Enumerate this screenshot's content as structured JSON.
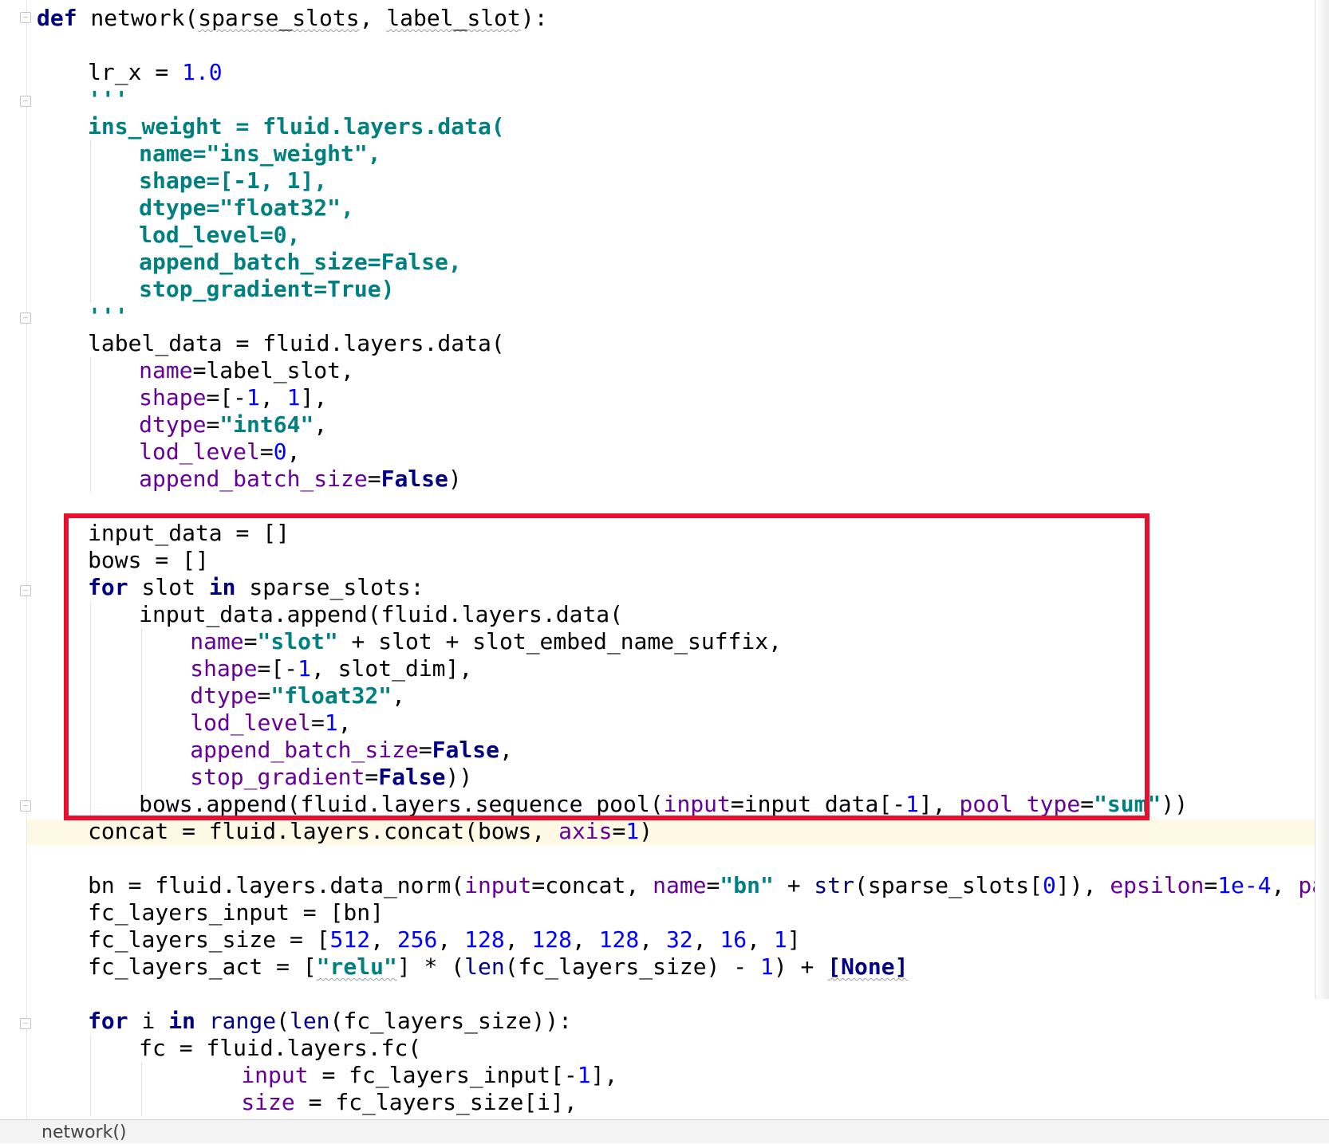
{
  "editor": {
    "lines": [
      {
        "indent": 0,
        "guides": [],
        "tokens": [
          {
            "t": "def",
            "c": "kw"
          },
          {
            "t": " network("
          },
          {
            "t": "sparse_slots",
            "c": "ul"
          },
          {
            "t": ", "
          },
          {
            "t": "label_slot",
            "c": "ul"
          },
          {
            "t": "):"
          }
        ]
      },
      {
        "indent": 0,
        "guides": [],
        "tokens": []
      },
      {
        "indent": 4,
        "guides": [],
        "tokens": [
          {
            "t": "lr_x = "
          },
          {
            "t": "1.0",
            "c": "num"
          }
        ]
      },
      {
        "indent": 4,
        "guides": [],
        "tokens": [
          {
            "t": "'''",
            "c": "doc"
          }
        ]
      },
      {
        "indent": 4,
        "guides": [],
        "tokens": [
          {
            "t": "ins_weight = fluid.layers.data(",
            "c": "doc"
          }
        ]
      },
      {
        "indent": 8,
        "guides": [
          4
        ],
        "tokens": [
          {
            "t": "name=\"ins_weight\",",
            "c": "doc"
          }
        ]
      },
      {
        "indent": 8,
        "guides": [
          4
        ],
        "tokens": [
          {
            "t": "shape=[-1, 1],",
            "c": "doc"
          }
        ]
      },
      {
        "indent": 8,
        "guides": [
          4
        ],
        "tokens": [
          {
            "t": "dtype=\"float32\",",
            "c": "doc"
          }
        ]
      },
      {
        "indent": 8,
        "guides": [
          4
        ],
        "tokens": [
          {
            "t": "lod_level=0,",
            "c": "doc"
          }
        ]
      },
      {
        "indent": 8,
        "guides": [
          4
        ],
        "tokens": [
          {
            "t": "append_batch_size=False,",
            "c": "doc"
          }
        ]
      },
      {
        "indent": 8,
        "guides": [
          4
        ],
        "tokens": [
          {
            "t": "stop_gradient=True)",
            "c": "doc"
          }
        ]
      },
      {
        "indent": 4,
        "guides": [],
        "tokens": [
          {
            "t": "'''",
            "c": "doc"
          }
        ]
      },
      {
        "indent": 4,
        "guides": [],
        "tokens": [
          {
            "t": "label_data = fluid.layers.data("
          }
        ]
      },
      {
        "indent": 8,
        "guides": [
          4
        ],
        "tokens": [
          {
            "t": "name",
            "c": "prm"
          },
          {
            "t": "=label_slot,"
          }
        ]
      },
      {
        "indent": 8,
        "guides": [
          4
        ],
        "tokens": [
          {
            "t": "shape",
            "c": "prm"
          },
          {
            "t": "=[-"
          },
          {
            "t": "1",
            "c": "num"
          },
          {
            "t": ", "
          },
          {
            "t": "1",
            "c": "num"
          },
          {
            "t": "],"
          }
        ]
      },
      {
        "indent": 8,
        "guides": [
          4
        ],
        "tokens": [
          {
            "t": "dtype",
            "c": "prm"
          },
          {
            "t": "="
          },
          {
            "t": "\"int64\"",
            "c": "str"
          },
          {
            "t": ","
          }
        ]
      },
      {
        "indent": 8,
        "guides": [
          4
        ],
        "tokens": [
          {
            "t": "lod_level",
            "c": "prm"
          },
          {
            "t": "="
          },
          {
            "t": "0",
            "c": "num"
          },
          {
            "t": ","
          }
        ]
      },
      {
        "indent": 8,
        "guides": [
          4
        ],
        "tokens": [
          {
            "t": "append_batch_size",
            "c": "prm"
          },
          {
            "t": "="
          },
          {
            "t": "False",
            "c": "kw"
          },
          {
            "t": ")"
          }
        ]
      },
      {
        "indent": 0,
        "guides": [],
        "tokens": []
      },
      {
        "indent": 4,
        "guides": [],
        "tokens": [
          {
            "t": "input_data = []"
          }
        ]
      },
      {
        "indent": 4,
        "guides": [],
        "tokens": [
          {
            "t": "bows = []"
          }
        ]
      },
      {
        "indent": 4,
        "guides": [],
        "tokens": [
          {
            "t": "for",
            "c": "kw"
          },
          {
            "t": " slot "
          },
          {
            "t": "in",
            "c": "kw"
          },
          {
            "t": " sparse_slots:"
          }
        ]
      },
      {
        "indent": 8,
        "guides": [
          4
        ],
        "tokens": [
          {
            "t": "input_data.append(fluid.layers.data("
          }
        ]
      },
      {
        "indent": 12,
        "guides": [
          4,
          8
        ],
        "tokens": [
          {
            "t": "name",
            "c": "prm"
          },
          {
            "t": "="
          },
          {
            "t": "\"slot\"",
            "c": "str"
          },
          {
            "t": " + slot + slot_embed_name_suffix,"
          }
        ]
      },
      {
        "indent": 12,
        "guides": [
          4,
          8
        ],
        "tokens": [
          {
            "t": "shape",
            "c": "prm"
          },
          {
            "t": "=[-"
          },
          {
            "t": "1",
            "c": "num"
          },
          {
            "t": ", slot_dim],"
          }
        ]
      },
      {
        "indent": 12,
        "guides": [
          4,
          8
        ],
        "tokens": [
          {
            "t": "dtype",
            "c": "prm"
          },
          {
            "t": "="
          },
          {
            "t": "\"float32\"",
            "c": "str"
          },
          {
            "t": ","
          }
        ]
      },
      {
        "indent": 12,
        "guides": [
          4,
          8
        ],
        "tokens": [
          {
            "t": "lod_level",
            "c": "prm"
          },
          {
            "t": "="
          },
          {
            "t": "1",
            "c": "num"
          },
          {
            "t": ","
          }
        ]
      },
      {
        "indent": 12,
        "guides": [
          4,
          8
        ],
        "tokens": [
          {
            "t": "append_batch_size",
            "c": "prm"
          },
          {
            "t": "="
          },
          {
            "t": "False",
            "c": "kw"
          },
          {
            "t": ","
          }
        ]
      },
      {
        "indent": 12,
        "guides": [
          4,
          8
        ],
        "tokens": [
          {
            "t": "stop_gradient",
            "c": "prm"
          },
          {
            "t": "="
          },
          {
            "t": "False",
            "c": "kw"
          },
          {
            "t": "))"
          }
        ]
      },
      {
        "indent": 8,
        "guides": [
          4
        ],
        "tokens": [
          {
            "t": "bows.append(fluid.layers.sequence_pool("
          },
          {
            "t": "input",
            "c": "prm"
          },
          {
            "t": "=input_data[-"
          },
          {
            "t": "1",
            "c": "num"
          },
          {
            "t": "], "
          },
          {
            "t": "pool_type",
            "c": "prm"
          },
          {
            "t": "="
          },
          {
            "t": "\"sum\"",
            "c": "str"
          },
          {
            "t": "))"
          }
        ]
      },
      {
        "indent": 4,
        "guides": [],
        "tokens": [
          {
            "t": "concat = fluid.layers.concat(bows, "
          },
          {
            "t": "axis",
            "c": "prm"
          },
          {
            "t": "="
          },
          {
            "t": "1",
            "c": "num"
          },
          {
            "t": ")"
          }
        ]
      },
      {
        "indent": 0,
        "guides": [],
        "tokens": []
      },
      {
        "indent": 4,
        "guides": [],
        "tokens": [
          {
            "t": "bn = fluid.layers.data_norm("
          },
          {
            "t": "input",
            "c": "prm"
          },
          {
            "t": "=concat, "
          },
          {
            "t": "name",
            "c": "prm"
          },
          {
            "t": "="
          },
          {
            "t": "\"bn\"",
            "c": "str"
          },
          {
            "t": " + "
          },
          {
            "t": "str",
            "c": "bi"
          },
          {
            "t": "(sparse_slots["
          },
          {
            "t": "0",
            "c": "num"
          },
          {
            "t": "]), "
          },
          {
            "t": "epsilon",
            "c": "prm"
          },
          {
            "t": "="
          },
          {
            "t": "1e-4",
            "c": "num"
          },
          {
            "t": ", "
          },
          {
            "t": "param_a",
            "c": "prm"
          }
        ]
      },
      {
        "indent": 4,
        "guides": [],
        "tokens": [
          {
            "t": "fc_layers_input = [bn]"
          }
        ]
      },
      {
        "indent": 4,
        "guides": [],
        "tokens": [
          {
            "t": "fc_layers_size = ["
          },
          {
            "t": "512",
            "c": "num"
          },
          {
            "t": ", "
          },
          {
            "t": "256",
            "c": "num"
          },
          {
            "t": ", "
          },
          {
            "t": "128",
            "c": "num"
          },
          {
            "t": ", "
          },
          {
            "t": "128",
            "c": "num"
          },
          {
            "t": ", "
          },
          {
            "t": "128",
            "c": "num"
          },
          {
            "t": ", "
          },
          {
            "t": "32",
            "c": "num"
          },
          {
            "t": ", "
          },
          {
            "t": "16",
            "c": "num"
          },
          {
            "t": ", "
          },
          {
            "t": "1",
            "c": "num"
          },
          {
            "t": "]"
          }
        ]
      },
      {
        "indent": 4,
        "guides": [],
        "tokens": [
          {
            "t": "fc_layers_act = ["
          },
          {
            "t": "\"relu\"",
            "c": "str ul"
          },
          {
            "t": "] * ("
          },
          {
            "t": "len",
            "c": "bi"
          },
          {
            "t": "(fc_layers_size) - "
          },
          {
            "t": "1",
            "c": "num"
          },
          {
            "t": ") + "
          },
          {
            "t": "[None]",
            "c": "kw ul"
          }
        ]
      },
      {
        "indent": 0,
        "guides": [],
        "tokens": []
      },
      {
        "indent": 4,
        "guides": [],
        "tokens": [
          {
            "t": "for",
            "c": "kw"
          },
          {
            "t": " i "
          },
          {
            "t": "in",
            "c": "kw"
          },
          {
            "t": " "
          },
          {
            "t": "range",
            "c": "bi"
          },
          {
            "t": "("
          },
          {
            "t": "len",
            "c": "bi"
          },
          {
            "t": "(fc_layers_size)):"
          }
        ]
      },
      {
        "indent": 8,
        "guides": [
          4
        ],
        "tokens": [
          {
            "t": "fc = fluid.layers.fc("
          }
        ]
      },
      {
        "indent": 16,
        "guides": [
          4,
          8
        ],
        "tokens": [
          {
            "t": "input",
            "c": "prm"
          },
          {
            "t": " = fc_layers_input[-"
          },
          {
            "t": "1",
            "c": "num"
          },
          {
            "t": "],"
          }
        ]
      },
      {
        "indent": 16,
        "guides": [
          4,
          8
        ],
        "tokens": [
          {
            "t": "size",
            "c": "prm"
          },
          {
            "t": " = fc_layers_size[i],"
          }
        ]
      }
    ]
  },
  "statusbar": {
    "breadcrumb": "network()"
  }
}
